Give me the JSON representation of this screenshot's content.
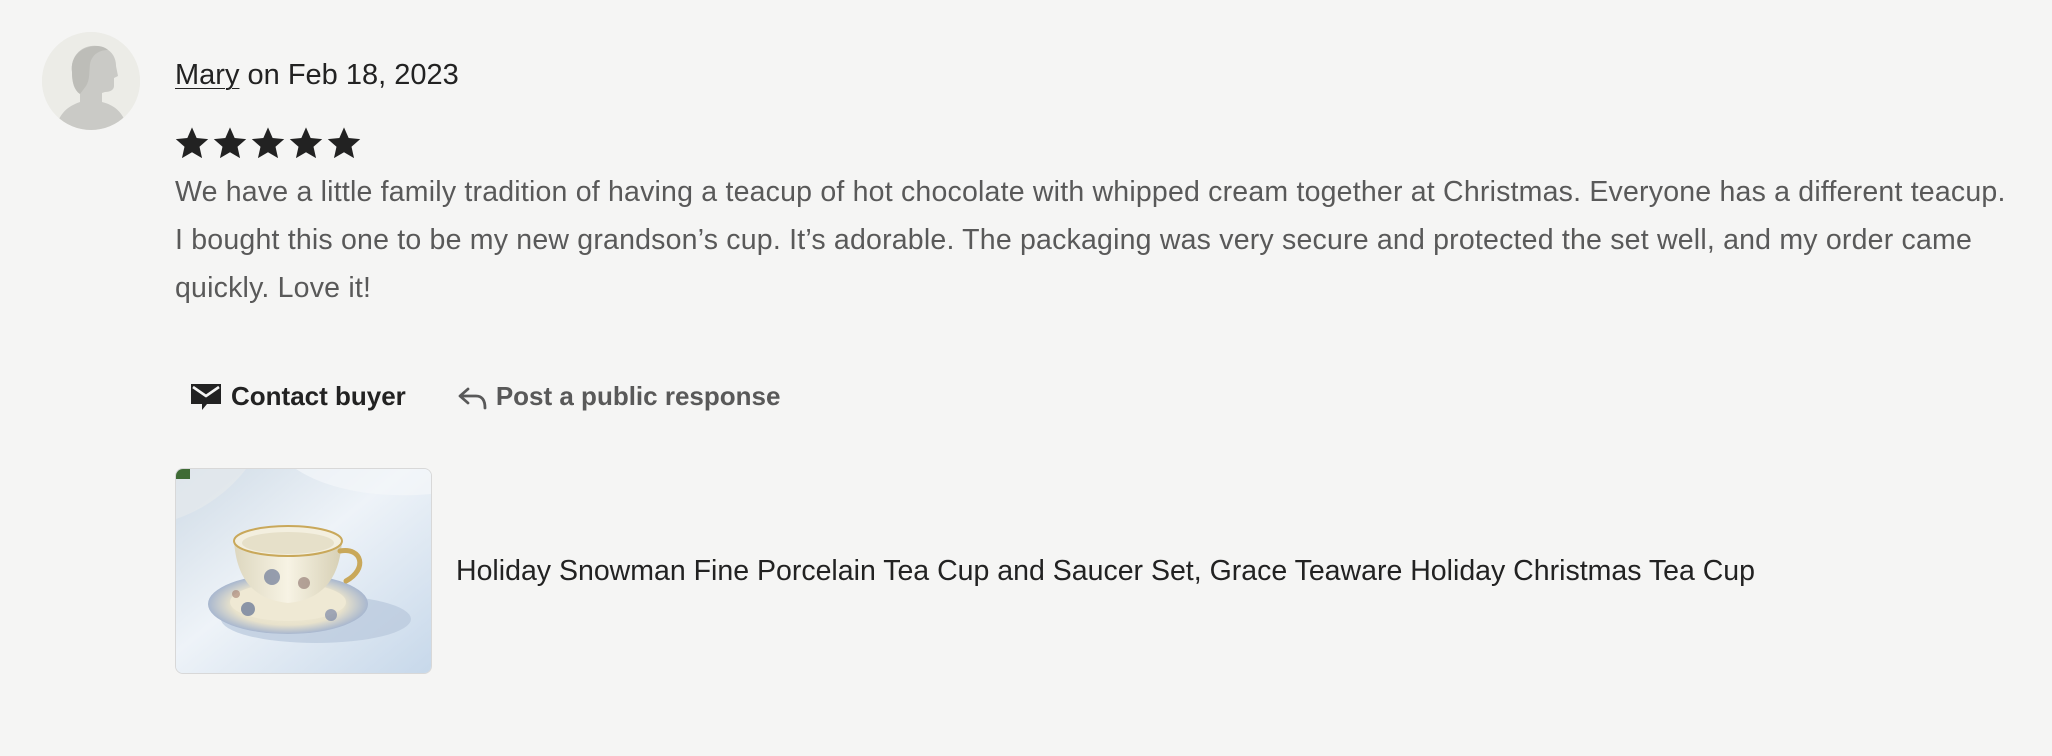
{
  "review": {
    "reviewer_name": "Mary",
    "date_text": " on Feb 18, 2023",
    "rating": 5,
    "rating_max": 5,
    "text": "We have a little family tradition of having a teacup of hot chocolate with whipped cream together at Christmas. Everyone has a different teacup. I bought this one to be my new grandson’s cup. It’s adorable. The packaging was very secure and protected the set well, and my order came quickly. Love it!"
  },
  "actions": {
    "contact_label": "Contact buyer",
    "contact_icon": "envelope-icon",
    "respond_label": "Post a public response",
    "respond_icon": "reply-arrow-icon"
  },
  "product": {
    "title": "Holiday Snowman Fine Porcelain Tea Cup and Saucer Set, Grace Teaware Holiday Christmas Tea Cup"
  },
  "colors": {
    "background": "#f5f5f4",
    "primary_text": "#222222",
    "secondary_text": "#595959",
    "star": "#222222"
  }
}
